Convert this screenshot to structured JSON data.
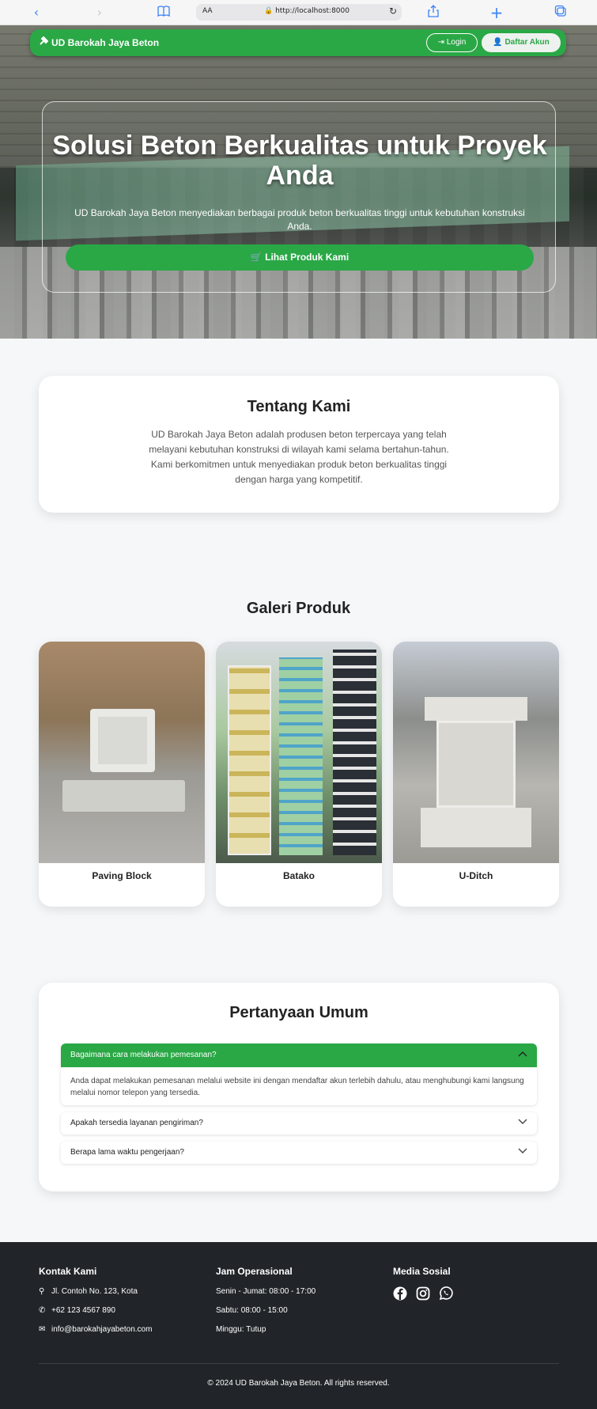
{
  "browser": {
    "aa_label": "AA",
    "url": "http://localhost:8000"
  },
  "nav": {
    "brand": "UD Barokah Jaya Beton",
    "login": "Login",
    "register": "Daftar Akun"
  },
  "hero": {
    "title": "Solusi Beton Berkualitas untuk Proyek Anda",
    "subtitle": "UD Barokah Jaya Beton menyediakan berbagai produk beton berkualitas tinggi untuk kebutuhan konstruksi Anda.",
    "cta": "Lihat Produk Kami"
  },
  "about": {
    "title": "Tentang Kami",
    "text": "UD Barokah Jaya Beton adalah produsen beton terpercaya yang telah melayani kebutuhan konstruksi di wilayah kami selama bertahun-tahun. Kami berkomitmen untuk menyediakan produk beton berkualitas tinggi dengan harga yang kompetitif."
  },
  "gallery": {
    "title": "Galeri Produk",
    "items": [
      {
        "name": "Paving Block"
      },
      {
        "name": "Batako"
      },
      {
        "name": "U-Ditch"
      }
    ]
  },
  "faq": {
    "title": "Pertanyaan Umum",
    "items": [
      {
        "question": "Bagaimana cara melakukan pemesanan?",
        "answer": "Anda dapat melakukan pemesanan melalui website ini dengan mendaftar akun terlebih dahulu, atau menghubungi kami langsung melalui nomor telepon yang tersedia.",
        "open": true
      },
      {
        "question": "Apakah tersedia layanan pengiriman?",
        "open": false
      },
      {
        "question": "Berapa lama waktu pengerjaan?",
        "open": false
      }
    ]
  },
  "footer": {
    "contact_title": "Kontak Kami",
    "address": "Jl. Contoh No. 123, Kota",
    "phone": "+62 123 4567 890",
    "email": "info@barokahjayabeton.com",
    "hours_title": "Jam Operasional",
    "hours": [
      "Senin - Jumat: 08:00 - 17:00",
      "Sabtu: 08:00 - 15:00",
      "Minggu: Tutup"
    ],
    "social_title": "Media Sosial",
    "social_icons": [
      "facebook-icon",
      "instagram-icon",
      "whatsapp-icon"
    ],
    "copyright": "© 2024 UD Barokah Jaya Beton. All rights reserved."
  },
  "colors": {
    "brand_green": "#2aa846",
    "footer_bg": "#212529",
    "page_bg": "#f5f7f9"
  }
}
